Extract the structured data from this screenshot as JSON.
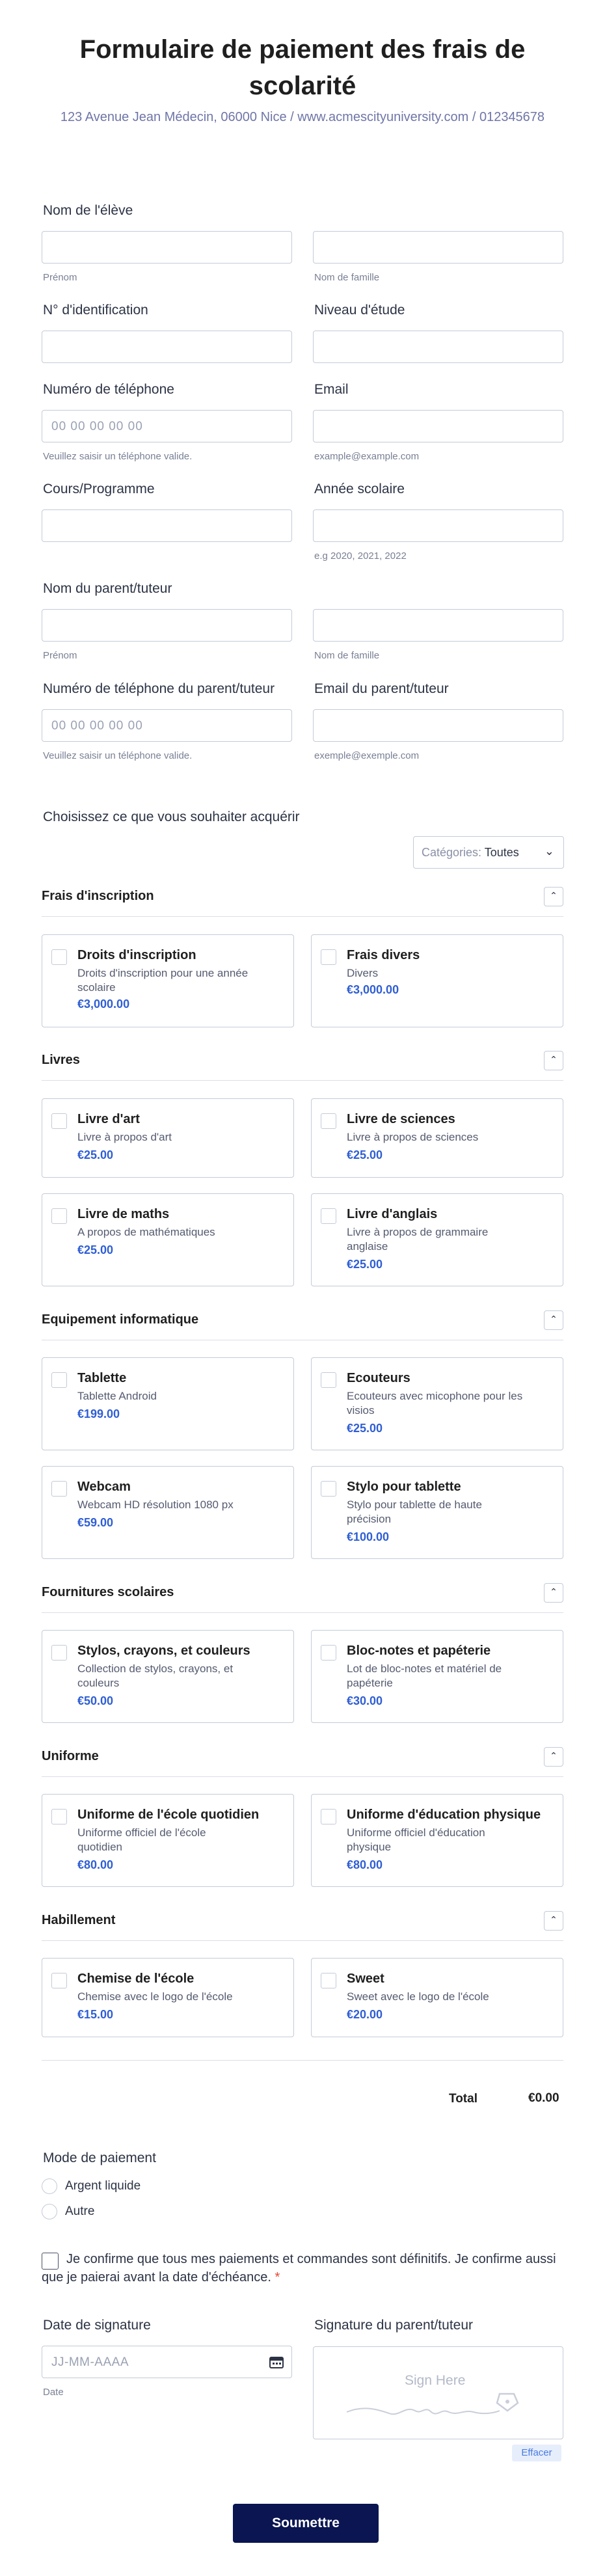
{
  "header": {
    "title": "Formulaire de paiement des frais de scolarité",
    "subtitle": "123 Avenue Jean Médecin, 06000 Nice / www.acmescityuniversity.com / 012345678"
  },
  "student": {
    "name_label": "Nom de l'élève",
    "first_sub": "Prénom",
    "last_sub": "Nom de famille",
    "id_label": "N° d'identification",
    "level_label": "Niveau d'étude",
    "phone_label": "Numéro de téléphone",
    "phone_placeholder": "00 00 00 00 00",
    "phone_sub": "Veuillez saisir un téléphone valide.",
    "email_label": "Email",
    "email_sub": "example@example.com",
    "course_label": "Cours/Programme",
    "year_label": "Année scolaire",
    "year_sub": "e.g 2020, 2021, 2022"
  },
  "parent": {
    "name_label": "Nom du parent/tuteur",
    "first_sub": "Prénom",
    "last_sub": "Nom de famille",
    "phone_label": "Numéro de téléphone du parent/tuteur",
    "phone_placeholder": "00 00 00 00 00",
    "phone_sub": "Veuillez saisir un téléphone valide.",
    "email_label": "Email du parent/tuteur",
    "email_sub": "exemple@exemple.com"
  },
  "products": {
    "prompt": "Choisissez ce que vous souhaiter acquérir",
    "category_label": "Catégories:",
    "category_value": "Toutes",
    "sections": [
      {
        "title": "Frais d'inscription",
        "items": [
          {
            "name": "Droits d'inscription",
            "desc": "Droits d'inscription pour une année scolaire",
            "price": "€3,000.00"
          },
          {
            "name": "Frais divers",
            "desc": "Divers",
            "price": "€3,000.00"
          }
        ]
      },
      {
        "title": "Livres",
        "items": [
          {
            "name": "Livre d'art",
            "desc": "Livre à propos d'art",
            "price": "€25.00"
          },
          {
            "name": "Livre de sciences",
            "desc": "Livre à propos de sciences",
            "price": "€25.00"
          },
          {
            "name": "Livre de maths",
            "desc": "A propos de mathématiques",
            "price": "€25.00"
          },
          {
            "name": "Livre d'anglais",
            "desc": "Livre à propos de grammaire anglaise",
            "price": "€25.00"
          }
        ]
      },
      {
        "title": "Equipement informatique",
        "items": [
          {
            "name": "Tablette",
            "desc": "Tablette Android",
            "price": "€199.00"
          },
          {
            "name": "Ecouteurs",
            "desc": "Ecouteurs avec micophone pour les visios",
            "price": "€25.00"
          },
          {
            "name": "Webcam",
            "desc": "Webcam HD résolution 1080 px",
            "price": "€59.00"
          },
          {
            "name": "Stylo pour tablette",
            "desc": "Stylo pour tablette de haute précision",
            "price": "€100.00"
          }
        ]
      },
      {
        "title": "Fournitures scolaires",
        "items": [
          {
            "name": "Stylos, crayons, et couleurs",
            "desc": "Collection de stylos, crayons, et couleurs",
            "price": "€50.00"
          },
          {
            "name": "Bloc-notes et papéterie",
            "desc": "Lot de bloc-notes et matériel de papéterie",
            "price": "€30.00"
          }
        ]
      },
      {
        "title": "Uniforme",
        "items": [
          {
            "name": "Uniforme de l'école quotidien",
            "desc": "Uniforme officiel de l'école quotidien",
            "price": "€80.00"
          },
          {
            "name": "Uniforme d'éducation physique",
            "desc": "Uniforme officiel d'éducation physique",
            "price": "€80.00"
          }
        ]
      },
      {
        "title": "Habillement",
        "items": [
          {
            "name": "Chemise de l'école",
            "desc": "Chemise avec le logo de l'école",
            "price": "€15.00"
          },
          {
            "name": "Sweet",
            "desc": "Sweet avec le logo de l'école",
            "price": "€20.00"
          }
        ]
      }
    ],
    "total_label": "Total",
    "total_value": "€0.00"
  },
  "payment": {
    "label": "Mode de paiement",
    "options": [
      "Argent liquide",
      "Autre"
    ]
  },
  "confirmation": {
    "text": "Je confirme que tous mes paiements et commandes sont définitifs. Je confirme aussi que je paierai avant la date d'échéance.",
    "required_mark": "*"
  },
  "signature": {
    "date_label": "Date de signature",
    "date_placeholder": "JJ-MM-AAAA",
    "date_sub": "Date",
    "sig_label": "Signature du parent/tuteur",
    "sig_hint": "Sign Here",
    "clear_label": "Effacer"
  },
  "submit_label": "Soumettre",
  "colors": {
    "price": "#2f5ed4",
    "submit": "#0a1551",
    "required": "#e8442f"
  }
}
